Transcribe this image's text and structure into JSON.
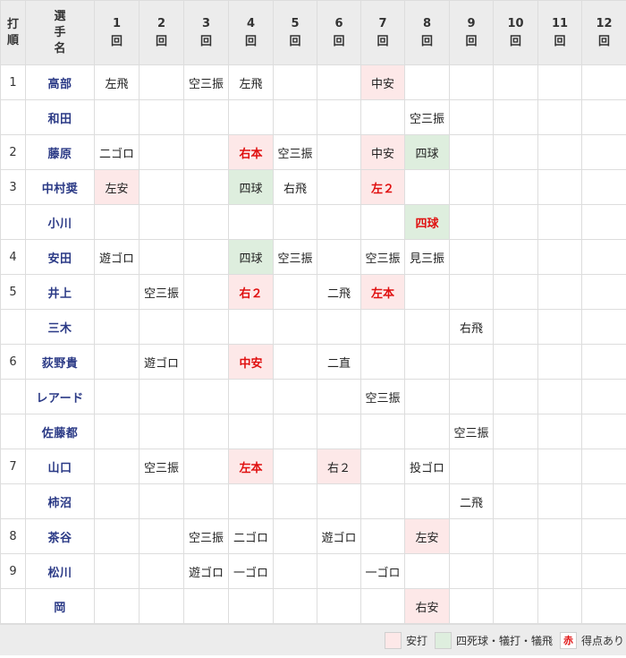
{
  "header": {
    "order_label": "打順",
    "player_label": "選手名",
    "inning_unit": "回",
    "innings": [
      "1",
      "2",
      "3",
      "4",
      "5",
      "6",
      "7",
      "8",
      "9",
      "10",
      "11",
      "12"
    ]
  },
  "rows": [
    {
      "order": "1",
      "name": "高部",
      "cells": [
        {
          "t": "左飛",
          "k": ""
        },
        {
          "t": "",
          "k": ""
        },
        {
          "t": "空三振",
          "k": ""
        },
        {
          "t": "左飛",
          "k": ""
        },
        {
          "t": "",
          "k": ""
        },
        {
          "t": "",
          "k": ""
        },
        {
          "t": "中安",
          "k": "hit"
        },
        {
          "t": "",
          "k": ""
        },
        {
          "t": "",
          "k": ""
        },
        {
          "t": "",
          "k": ""
        },
        {
          "t": "",
          "k": ""
        },
        {
          "t": "",
          "k": ""
        }
      ]
    },
    {
      "order": "",
      "name": "和田",
      "cells": [
        {
          "t": "",
          "k": ""
        },
        {
          "t": "",
          "k": ""
        },
        {
          "t": "",
          "k": ""
        },
        {
          "t": "",
          "k": ""
        },
        {
          "t": "",
          "k": ""
        },
        {
          "t": "",
          "k": ""
        },
        {
          "t": "",
          "k": ""
        },
        {
          "t": "空三振",
          "k": ""
        },
        {
          "t": "",
          "k": ""
        },
        {
          "t": "",
          "k": ""
        },
        {
          "t": "",
          "k": ""
        },
        {
          "t": "",
          "k": ""
        }
      ]
    },
    {
      "order": "2",
      "name": "藤原",
      "cells": [
        {
          "t": "二ゴロ",
          "k": ""
        },
        {
          "t": "",
          "k": ""
        },
        {
          "t": "",
          "k": ""
        },
        {
          "t": "右本",
          "k": "hit run"
        },
        {
          "t": "空三振",
          "k": ""
        },
        {
          "t": "",
          "k": ""
        },
        {
          "t": "中安",
          "k": "hit"
        },
        {
          "t": "四球",
          "k": "walk"
        },
        {
          "t": "",
          "k": ""
        },
        {
          "t": "",
          "k": ""
        },
        {
          "t": "",
          "k": ""
        },
        {
          "t": "",
          "k": ""
        }
      ]
    },
    {
      "order": "3",
      "name": "中村奨",
      "cells": [
        {
          "t": "左安",
          "k": "hit"
        },
        {
          "t": "",
          "k": ""
        },
        {
          "t": "",
          "k": ""
        },
        {
          "t": "四球",
          "k": "walk"
        },
        {
          "t": "右飛",
          "k": ""
        },
        {
          "t": "",
          "k": ""
        },
        {
          "t": "左２",
          "k": "hit run"
        },
        {
          "t": "",
          "k": ""
        },
        {
          "t": "",
          "k": ""
        },
        {
          "t": "",
          "k": ""
        },
        {
          "t": "",
          "k": ""
        },
        {
          "t": "",
          "k": ""
        }
      ]
    },
    {
      "order": "",
      "name": "小川",
      "cells": [
        {
          "t": "",
          "k": ""
        },
        {
          "t": "",
          "k": ""
        },
        {
          "t": "",
          "k": ""
        },
        {
          "t": "",
          "k": ""
        },
        {
          "t": "",
          "k": ""
        },
        {
          "t": "",
          "k": ""
        },
        {
          "t": "",
          "k": ""
        },
        {
          "t": "四球",
          "k": "walk run"
        },
        {
          "t": "",
          "k": ""
        },
        {
          "t": "",
          "k": ""
        },
        {
          "t": "",
          "k": ""
        },
        {
          "t": "",
          "k": ""
        }
      ]
    },
    {
      "order": "4",
      "name": "安田",
      "cells": [
        {
          "t": "遊ゴロ",
          "k": ""
        },
        {
          "t": "",
          "k": ""
        },
        {
          "t": "",
          "k": ""
        },
        {
          "t": "四球",
          "k": "walk"
        },
        {
          "t": "空三振",
          "k": ""
        },
        {
          "t": "",
          "k": ""
        },
        {
          "t": "空三振",
          "k": ""
        },
        {
          "t": "見三振",
          "k": ""
        },
        {
          "t": "",
          "k": ""
        },
        {
          "t": "",
          "k": ""
        },
        {
          "t": "",
          "k": ""
        },
        {
          "t": "",
          "k": ""
        }
      ]
    },
    {
      "order": "5",
      "name": "井上",
      "cells": [
        {
          "t": "",
          "k": ""
        },
        {
          "t": "空三振",
          "k": ""
        },
        {
          "t": "",
          "k": ""
        },
        {
          "t": "右２",
          "k": "hit run"
        },
        {
          "t": "",
          "k": ""
        },
        {
          "t": "二飛",
          "k": ""
        },
        {
          "t": "左本",
          "k": "hit run"
        },
        {
          "t": "",
          "k": ""
        },
        {
          "t": "",
          "k": ""
        },
        {
          "t": "",
          "k": ""
        },
        {
          "t": "",
          "k": ""
        },
        {
          "t": "",
          "k": ""
        }
      ]
    },
    {
      "order": "",
      "name": "三木",
      "cells": [
        {
          "t": "",
          "k": ""
        },
        {
          "t": "",
          "k": ""
        },
        {
          "t": "",
          "k": ""
        },
        {
          "t": "",
          "k": ""
        },
        {
          "t": "",
          "k": ""
        },
        {
          "t": "",
          "k": ""
        },
        {
          "t": "",
          "k": ""
        },
        {
          "t": "",
          "k": ""
        },
        {
          "t": "右飛",
          "k": ""
        },
        {
          "t": "",
          "k": ""
        },
        {
          "t": "",
          "k": ""
        },
        {
          "t": "",
          "k": ""
        }
      ]
    },
    {
      "order": "6",
      "name": "荻野貴",
      "cells": [
        {
          "t": "",
          "k": ""
        },
        {
          "t": "遊ゴロ",
          "k": ""
        },
        {
          "t": "",
          "k": ""
        },
        {
          "t": "中安",
          "k": "hit run"
        },
        {
          "t": "",
          "k": ""
        },
        {
          "t": "二直",
          "k": ""
        },
        {
          "t": "",
          "k": ""
        },
        {
          "t": "",
          "k": ""
        },
        {
          "t": "",
          "k": ""
        },
        {
          "t": "",
          "k": ""
        },
        {
          "t": "",
          "k": ""
        },
        {
          "t": "",
          "k": ""
        }
      ]
    },
    {
      "order": "",
      "name": "レアード",
      "cells": [
        {
          "t": "",
          "k": ""
        },
        {
          "t": "",
          "k": ""
        },
        {
          "t": "",
          "k": ""
        },
        {
          "t": "",
          "k": ""
        },
        {
          "t": "",
          "k": ""
        },
        {
          "t": "",
          "k": ""
        },
        {
          "t": "空三振",
          "k": ""
        },
        {
          "t": "",
          "k": ""
        },
        {
          "t": "",
          "k": ""
        },
        {
          "t": "",
          "k": ""
        },
        {
          "t": "",
          "k": ""
        },
        {
          "t": "",
          "k": ""
        }
      ]
    },
    {
      "order": "",
      "name": "佐藤都",
      "cells": [
        {
          "t": "",
          "k": ""
        },
        {
          "t": "",
          "k": ""
        },
        {
          "t": "",
          "k": ""
        },
        {
          "t": "",
          "k": ""
        },
        {
          "t": "",
          "k": ""
        },
        {
          "t": "",
          "k": ""
        },
        {
          "t": "",
          "k": ""
        },
        {
          "t": "",
          "k": ""
        },
        {
          "t": "空三振",
          "k": ""
        },
        {
          "t": "",
          "k": ""
        },
        {
          "t": "",
          "k": ""
        },
        {
          "t": "",
          "k": ""
        }
      ]
    },
    {
      "order": "7",
      "name": "山口",
      "cells": [
        {
          "t": "",
          "k": ""
        },
        {
          "t": "空三振",
          "k": ""
        },
        {
          "t": "",
          "k": ""
        },
        {
          "t": "左本",
          "k": "hit run"
        },
        {
          "t": "",
          "k": ""
        },
        {
          "t": "右２",
          "k": "hit"
        },
        {
          "t": "",
          "k": ""
        },
        {
          "t": "投ゴロ",
          "k": ""
        },
        {
          "t": "",
          "k": ""
        },
        {
          "t": "",
          "k": ""
        },
        {
          "t": "",
          "k": ""
        },
        {
          "t": "",
          "k": ""
        }
      ]
    },
    {
      "order": "",
      "name": "柿沼",
      "cells": [
        {
          "t": "",
          "k": ""
        },
        {
          "t": "",
          "k": ""
        },
        {
          "t": "",
          "k": ""
        },
        {
          "t": "",
          "k": ""
        },
        {
          "t": "",
          "k": ""
        },
        {
          "t": "",
          "k": ""
        },
        {
          "t": "",
          "k": ""
        },
        {
          "t": "",
          "k": ""
        },
        {
          "t": "二飛",
          "k": ""
        },
        {
          "t": "",
          "k": ""
        },
        {
          "t": "",
          "k": ""
        },
        {
          "t": "",
          "k": ""
        }
      ]
    },
    {
      "order": "8",
      "name": "茶谷",
      "cells": [
        {
          "t": "",
          "k": ""
        },
        {
          "t": "",
          "k": ""
        },
        {
          "t": "空三振",
          "k": ""
        },
        {
          "t": "二ゴロ",
          "k": ""
        },
        {
          "t": "",
          "k": ""
        },
        {
          "t": "遊ゴロ",
          "k": ""
        },
        {
          "t": "",
          "k": ""
        },
        {
          "t": "左安",
          "k": "hit"
        },
        {
          "t": "",
          "k": ""
        },
        {
          "t": "",
          "k": ""
        },
        {
          "t": "",
          "k": ""
        },
        {
          "t": "",
          "k": ""
        }
      ]
    },
    {
      "order": "9",
      "name": "松川",
      "cells": [
        {
          "t": "",
          "k": ""
        },
        {
          "t": "",
          "k": ""
        },
        {
          "t": "遊ゴロ",
          "k": ""
        },
        {
          "t": "一ゴロ",
          "k": ""
        },
        {
          "t": "",
          "k": ""
        },
        {
          "t": "",
          "k": ""
        },
        {
          "t": "一ゴロ",
          "k": ""
        },
        {
          "t": "",
          "k": ""
        },
        {
          "t": "",
          "k": ""
        },
        {
          "t": "",
          "k": ""
        },
        {
          "t": "",
          "k": ""
        },
        {
          "t": "",
          "k": ""
        }
      ]
    },
    {
      "order": "",
      "name": "岡",
      "cells": [
        {
          "t": "",
          "k": ""
        },
        {
          "t": "",
          "k": ""
        },
        {
          "t": "",
          "k": ""
        },
        {
          "t": "",
          "k": ""
        },
        {
          "t": "",
          "k": ""
        },
        {
          "t": "",
          "k": ""
        },
        {
          "t": "",
          "k": ""
        },
        {
          "t": "右安",
          "k": "hit"
        },
        {
          "t": "",
          "k": ""
        },
        {
          "t": "",
          "k": ""
        },
        {
          "t": "",
          "k": ""
        },
        {
          "t": "",
          "k": ""
        }
      ]
    }
  ],
  "legend": {
    "hit": "安打",
    "walk": "四死球・犠打・犠飛",
    "run_mark": "赤",
    "run": "得点あり"
  },
  "colors": {
    "hit_bg": "#fde8e8",
    "walk_bg": "#deeede",
    "run_text": "#e01010",
    "player_text": "#2b3a86",
    "header_bg": "#ececec"
  }
}
